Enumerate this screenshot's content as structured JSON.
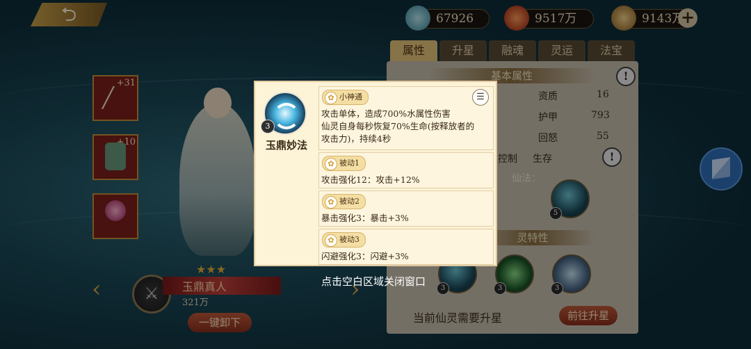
{
  "top": {
    "back_icon": "back-arrow-icon",
    "resources": [
      {
        "icon": "spirit-orb-icon",
        "value": "67926"
      },
      {
        "icon": "red-gem-icon",
        "value": "9517万"
      },
      {
        "icon": "coin-icon",
        "value": "9143万"
      }
    ],
    "plus_label": "+"
  },
  "tabs": [
    "属性",
    "升星",
    "融魂",
    "灵运",
    "法宝"
  ],
  "panel": {
    "basic_attributes": "基本属性",
    "stats": [
      {
        "label": "资质",
        "value": "16"
      },
      {
        "label": "护甲",
        "value": "793"
      },
      {
        "label": "回怒",
        "value": "55"
      }
    ],
    "control_label": "控制",
    "survive_label": "生存",
    "spell_label": "仙法：",
    "traits_title": "灵特性",
    "need_star_text": "当前仙灵需要升星",
    "goto_label": "前往升星",
    "orb_levels": [
      "5",
      "3",
      "3",
      "3"
    ]
  },
  "left": {
    "equip_levels": [
      "+31",
      "+10",
      ""
    ],
    "hero_name": "玉鼎真人",
    "hero_power": "321万",
    "unequip_label": "一键卸下",
    "stars": "★★★",
    "medal_symbol": "⚔"
  },
  "popup": {
    "skill_icon": "water-swirl-icon",
    "skill_level": "3",
    "skill_name": "玉鼎妙法",
    "main": {
      "tag": "小神通",
      "lines": [
        "攻击单体，造成700%水属性伤害",
        "仙灵自身每秒恢复70%生命(按释放者的",
        "攻击力)，持续4秒"
      ]
    },
    "passives": [
      {
        "tag": "被动1",
        "text": "攻击强化12：攻击+12%"
      },
      {
        "tag": "被动2",
        "text": "暴击强化3：暴击+3%"
      },
      {
        "tag": "被动3",
        "text": "闪避强化3：闪避+3%"
      }
    ]
  },
  "hint": "点击空白区域关闭窗口"
}
